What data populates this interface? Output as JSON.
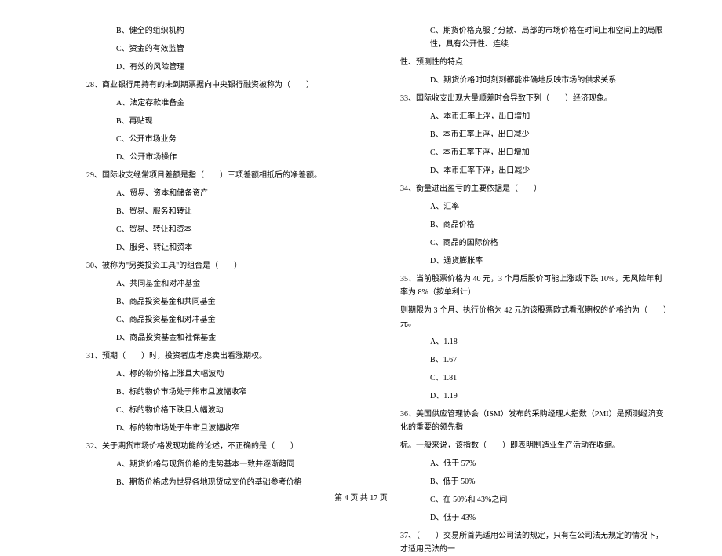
{
  "left_column": {
    "opt27_b": "B、健全的组织机构",
    "opt27_c": "C、资金的有效监管",
    "opt27_d": "D、有效的风险管理",
    "q28": "28、商业银行用持有的未到期票据向中央银行融资被称为（　　）",
    "opt28_a": "A、法定存款准备金",
    "opt28_b": "B、再贴现",
    "opt28_c": "C、公开市场业务",
    "opt28_d": "D、公开市场操作",
    "q29": "29、国际收支经常项目差额是指（　　）三项差额相抵后的净差额。",
    "opt29_a": "A、贸易、资本和储备资产",
    "opt29_b": "B、贸易、服务和转让",
    "opt29_c": "C、贸易、转让和资本",
    "opt29_d": "D、服务、转让和资本",
    "q30": "30、被称为\"另类投资工具\"的组合是（　　）",
    "opt30_a": "A、共同基金和对冲基金",
    "opt30_b": "B、商品投资基金和共同基金",
    "opt30_c": "C、商品投资基金和对冲基金",
    "opt30_d": "D、商品投资基金和社保基金",
    "q31": "31、预期（　　）时，投资者应考虑卖出看涨期权。",
    "opt31_a": "A、标的物价格上涨且大幅波动",
    "opt31_b": "B、标的物价市场处于熊市且波幅收窄",
    "opt31_c": "C、标的物价格下跌且大幅波动",
    "opt31_d": "D、标的物市场处于牛市且波幅收窄",
    "q32": "32、关于期货市场价格发现功能的论述，不正确的是（　　）",
    "opt32_a": "A、期货价格与现货价格的走势基本一致并逐渐趋同",
    "opt32_b": "B、期货价格成为世界各地现货成交价的基础参考价格"
  },
  "right_column": {
    "opt32_c": "C、期货价格克服了分散、局部的市场价格在时间上和空间上的局限性，具有公开性、连续",
    "opt32_c_cont": "性、预测性的特点",
    "opt32_d": "D、期货价格时时刻刻都能准确地反映市场的供求关系",
    "q33": "33、国际收支出现大量顺差时会导致下列（　　）经济现象。",
    "opt33_a": "A、本币汇率上浮，出口增加",
    "opt33_b": "B、本币汇率上浮，出口减少",
    "opt33_c": "C、本币汇率下浮，出口增加",
    "opt33_d": "D、本币汇率下浮，出口减少",
    "q34": "34、衡量进出盈亏的主要依据是（　　）",
    "opt34_a": "A、汇率",
    "opt34_b": "B、商品价格",
    "opt34_c": "C、商品的国际价格",
    "opt34_d": "D、通货膨胀率",
    "q35": "35、当前股票价格为 40 元，3 个月后股价可能上涨或下跌 10%，无风险年利率为 8%（按单利计）",
    "q35_cont": "则期限为 3 个月、执行价格为 42 元的该股票欧式看涨期权的价格约为（　　）元。",
    "opt35_a": "A、1.18",
    "opt35_b": "B、1.67",
    "opt35_c": "C、1.81",
    "opt35_d": "D、1.19",
    "q36": "36、美国供应管理协会（ISM）发布的采购经理人指数（PMI）是预测经济变化的重要的领先指",
    "q36_cont": "标。一般来说，该指数（　　）即表明制造业生产活动在收缩。",
    "opt36_a": "A、低于 57%",
    "opt36_b": "B、低于 50%",
    "opt36_c": "C、在 50%和 43%之间",
    "opt36_d": "D、低于 43%",
    "q37": "37、（　　）交易所首先适用公司法的规定，只有在公司法无规定的情况下，才适用民法的一"
  },
  "footer": "第 4 页 共 17 页"
}
